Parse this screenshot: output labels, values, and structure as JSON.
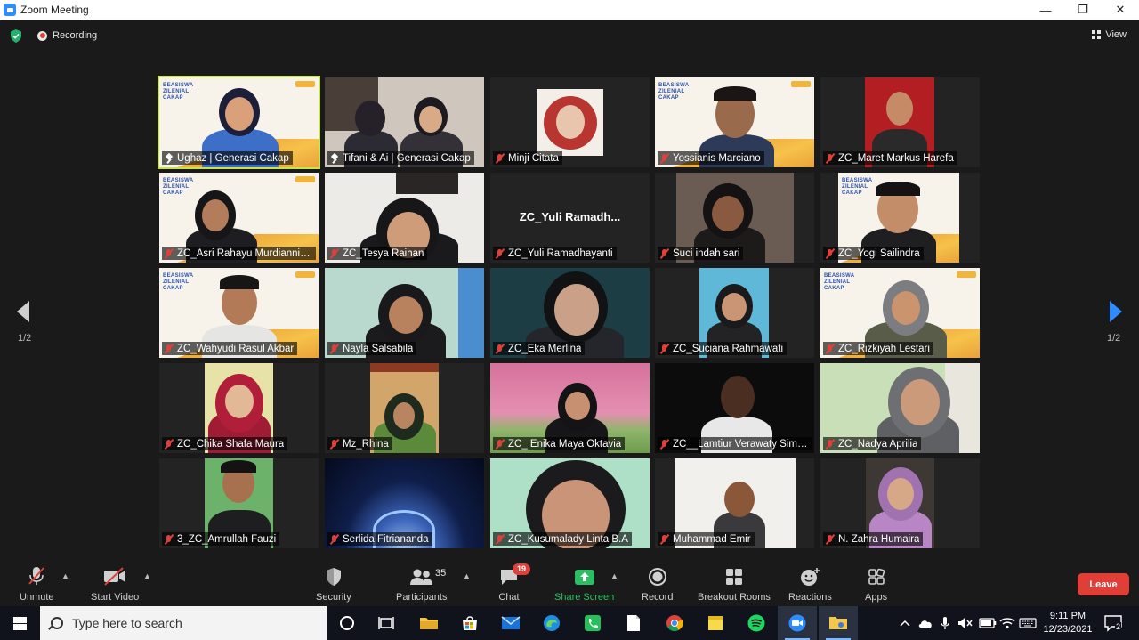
{
  "window": {
    "title": "Zoom Meeting",
    "controls": [
      "—",
      "❐",
      "✕"
    ]
  },
  "topbar": {
    "recording_label": "Recording",
    "view_label": "View"
  },
  "gallery": {
    "page_left": "1/2",
    "page_right": "1/2",
    "center_name_text": "ZC_Yuli  Ramadh...",
    "tiles": [
      {
        "name": "Ughaz | Generasi Cakap",
        "icon": "pin"
      },
      {
        "name": "Tifani & Ai | Generasi Cakap",
        "icon": "pin"
      },
      {
        "name": "Minji Citata",
        "icon": "mic-muted"
      },
      {
        "name": "Yossianis Marciano",
        "icon": "mic-muted"
      },
      {
        "name": "ZC_Maret Markus Harefa",
        "icon": "mic-muted"
      },
      {
        "name": "ZC_Asri Rahayu Murdianningsih",
        "icon": "mic-muted"
      },
      {
        "name": "ZC_Tesya Raihan",
        "icon": "mic-muted"
      },
      {
        "name": "ZC_Yuli Ramadhayanti",
        "icon": "mic-muted"
      },
      {
        "name": "Suci indah sari",
        "icon": "mic-muted"
      },
      {
        "name": "ZC_Yogi Sailindra",
        "icon": "mic-muted"
      },
      {
        "name": "ZC_Wahyudi Rasul Akbar",
        "icon": "mic-muted"
      },
      {
        "name": "Nayla Salsabila",
        "icon": "mic-muted"
      },
      {
        "name": "ZC_Eka Merlina",
        "icon": "mic-muted"
      },
      {
        "name": "ZC_Suciana Rahmawati",
        "icon": "mic-muted"
      },
      {
        "name": "ZC_Rizkiyah Lestari",
        "icon": "mic-muted"
      },
      {
        "name": "ZC_Chika Shafa Maura",
        "icon": "mic-muted"
      },
      {
        "name": "Mz_Rhina",
        "icon": "mic-muted"
      },
      {
        "name": "ZC_ Enika Maya Oktavia",
        "icon": "mic-muted"
      },
      {
        "name": "ZC__Lamtiur Verawaty Simbolon",
        "icon": "mic-muted"
      },
      {
        "name": "ZC_Nadya Aprilia",
        "icon": "mic-muted"
      },
      {
        "name": "3_ZC_Amrullah Fauzi",
        "icon": "mic-muted"
      },
      {
        "name": "Serlida Fitriananda",
        "icon": "mic-muted"
      },
      {
        "name": "ZC_Kusumalady Linta B.A",
        "icon": "mic-muted"
      },
      {
        "name": "Muhammad Emir",
        "icon": "mic-muted"
      },
      {
        "name": "N. Zahra Humaira",
        "icon": "mic-muted"
      }
    ]
  },
  "toolbar": {
    "unmute": "Unmute",
    "start_video": "Start Video",
    "security": "Security",
    "participants": "Participants",
    "participants_count": "35",
    "chat": "Chat",
    "chat_badge": "19",
    "share_screen": "Share Screen",
    "record": "Record",
    "breakout_rooms": "Breakout Rooms",
    "reactions": "Reactions",
    "apps": "Apps",
    "leave": "Leave"
  },
  "taskbar": {
    "search_placeholder": "Type here to search",
    "time": "9:11 PM",
    "date": "12/23/2021",
    "notification_count": "2"
  },
  "colors": {
    "active_speaker_border": "#c9e34a",
    "share_green": "#2dbd62",
    "leave_red": "#e03e36",
    "muted_red": "#e0403a",
    "nav_arrow_blue": "#2d8cff"
  }
}
